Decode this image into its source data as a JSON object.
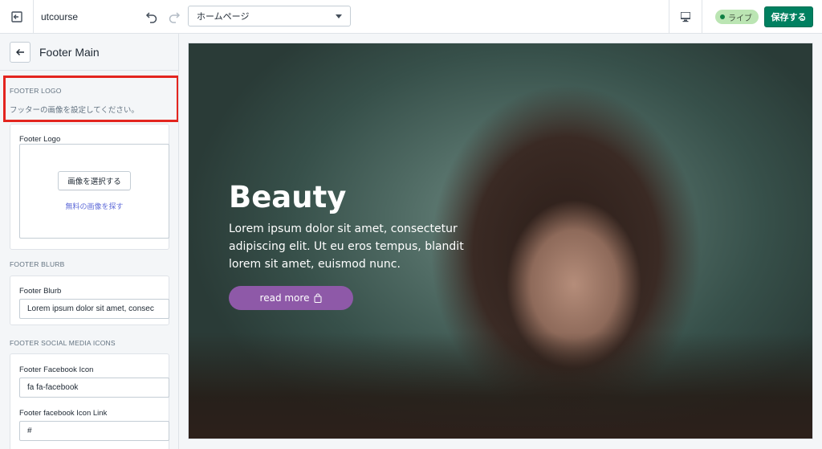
{
  "topbar": {
    "store_name": "utcourse",
    "page_select_value": "ホームページ",
    "live_label": "ライブ",
    "save_label": "保存する"
  },
  "sidebar": {
    "title": "Footer Main",
    "footer_logo_section": {
      "label": "FOOTER LOGO",
      "info": "フッターの画像を設定してください。",
      "field_label": "Footer Logo",
      "select_image_label": "画像を選択する",
      "free_images_link": "無料の画像を探す"
    },
    "footer_blurb_section": {
      "label": "FOOTER BLURB",
      "field_label": "Footer Blurb",
      "value": "Lorem ipsum dolor sit amet, consec"
    },
    "social_section": {
      "label": "FOOTER SOCIAL MEDIA ICONS",
      "facebook_icon_label": "Footer Facebook Icon",
      "facebook_icon_value": "fa fa-facebook",
      "facebook_link_label": "Footer facebook Icon Link",
      "facebook_link_value": "#"
    }
  },
  "preview": {
    "hero_title": "Beauty",
    "hero_text": "Lorem ipsum dolor sit amet, consectetur adipiscing elit. Ut eu eros tempus, blandit lorem sit amet, euismod nunc.",
    "button_label": "read more"
  },
  "colors": {
    "save_green": "#008060",
    "highlight_red": "#e3251f",
    "button_purple": "#8e59a8",
    "live_badge_bg": "#bbe5b3"
  }
}
